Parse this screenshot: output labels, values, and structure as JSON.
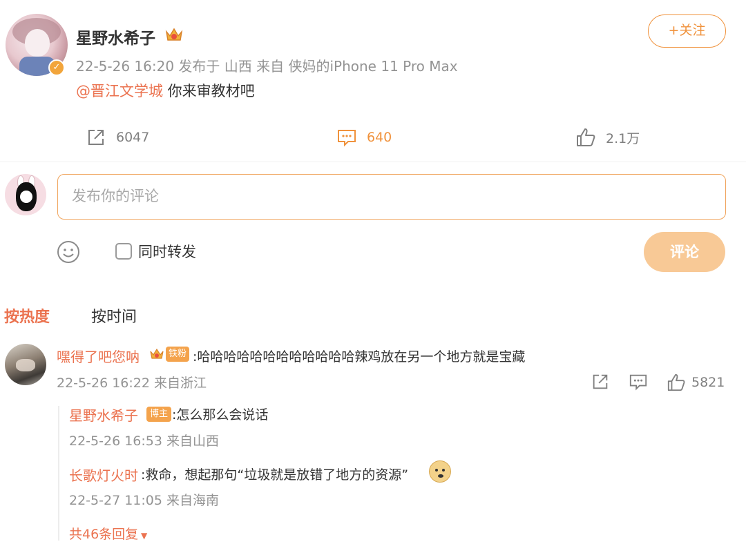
{
  "post": {
    "author": "星野水希子",
    "meta": "22-5-26 16:20  发布于 山西  来自 侠妈的iPhone 11 Pro Max",
    "mention": "@晋江文学城",
    "text": " 你来审教材吧",
    "follow_label": "+关注",
    "repost_count": "6047",
    "comment_count": "640",
    "like_count": "2.1万"
  },
  "composer": {
    "placeholder": "发布你的评论",
    "repost_label": "同时转发",
    "submit_label": "评论"
  },
  "sort": {
    "hot": "按热度",
    "time": "按时间"
  },
  "comment": {
    "author": "嘿得了吧您呐",
    "fan_badge": "铁粉",
    "text": ":哈哈哈哈哈哈哈哈哈哈哈哈辣鸡放在另一个地方就是宝藏",
    "meta": "22-5-26 16:22 来自浙江",
    "like_count": "5821"
  },
  "replies": [
    {
      "author": "星野水希子",
      "badge": "博主",
      "text": ":怎么那么会说话",
      "meta": "22-5-26 16:53 来自山西"
    },
    {
      "author": "长歌灯火时",
      "text": ":救命，想起那句“垃圾就是放错了地方的资源”",
      "meta": "22-5-27 11:05 来自海南"
    }
  ],
  "more_replies": "共46条回复",
  "colors": {
    "accent": "#eb7350",
    "orange": "#f0923c",
    "submit_bg": "#f8c996",
    "meta_gray": "#939393"
  }
}
